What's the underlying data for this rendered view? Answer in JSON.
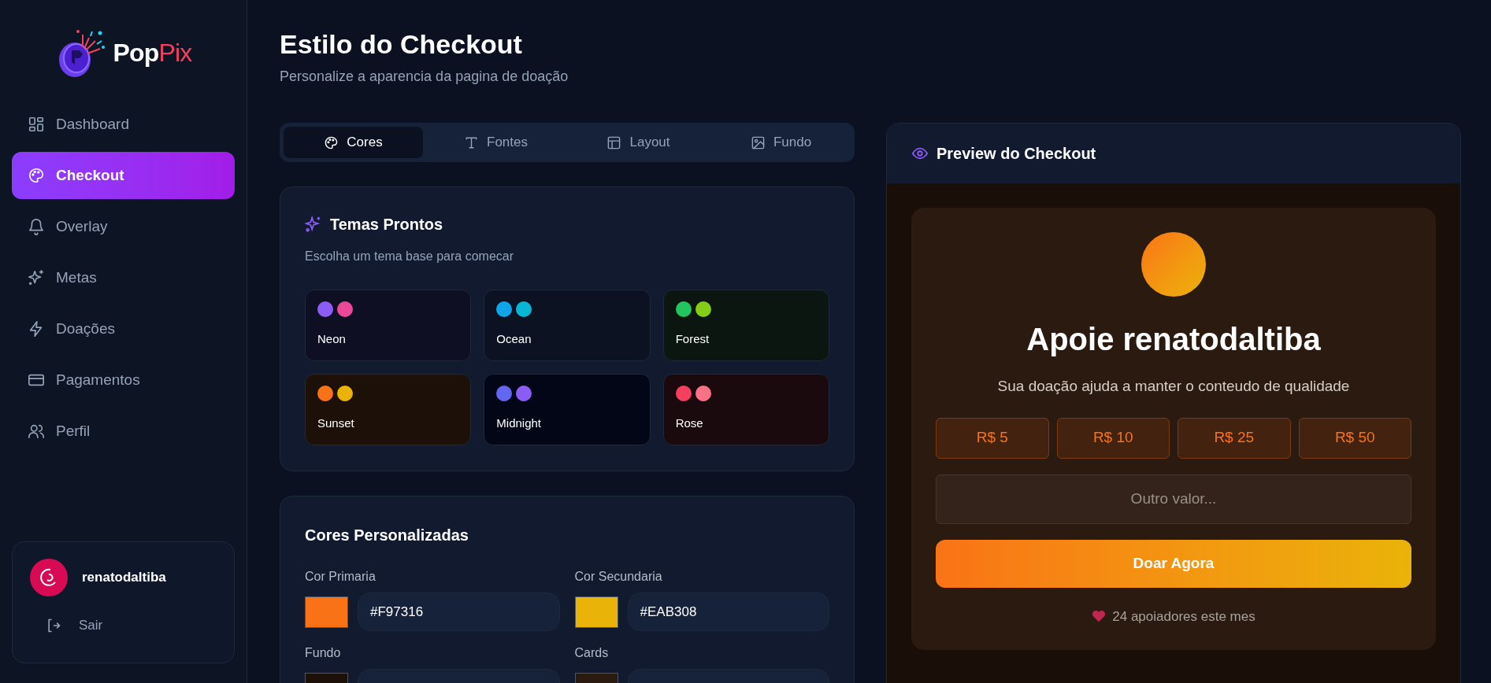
{
  "logo": {
    "part_1": "Pop",
    "part_2": "Pix"
  },
  "sidebar": {
    "items": [
      {
        "label": "Dashboard",
        "selected": false
      },
      {
        "label": "Checkout",
        "selected": true
      },
      {
        "label": "Overlay",
        "selected": false
      },
      {
        "label": "Metas",
        "selected": false
      },
      {
        "label": "Doações",
        "selected": false
      },
      {
        "label": "Pagamentos",
        "selected": false
      },
      {
        "label": "Perfil",
        "selected": false
      }
    ],
    "user": {
      "name": "renatodaltiba",
      "logout": "Sair"
    }
  },
  "page": {
    "title": "Estilo do Checkout",
    "subtitle": "Personalize a aparencia da pagina de doação"
  },
  "tabs": [
    {
      "label": "Cores",
      "selected": true
    },
    {
      "label": "Fontes",
      "selected": false
    },
    {
      "label": "Layout",
      "selected": false
    },
    {
      "label": "Fundo",
      "selected": false
    }
  ],
  "themes": {
    "title": "Temas Prontos",
    "subtitle": "Escolha um tema base para comecar",
    "items": [
      {
        "name": "Neon",
        "color": "#0f0f23",
        "dots": [
          {
            "color": "#8b5cf6"
          },
          {
            "color": "#ec4899"
          }
        ]
      },
      {
        "name": "Ocean",
        "color": "#0c1222",
        "dots": [
          {
            "color": "#0ea5e9"
          },
          {
            "color": "#06b6d4"
          }
        ]
      },
      {
        "name": "Forest",
        "color": "#0a160f",
        "dots": [
          {
            "color": "#22c55e"
          },
          {
            "color": "#84cc16"
          }
        ]
      },
      {
        "name": "Sunset",
        "color": "#1c1008",
        "dots": [
          {
            "color": "#f97316"
          },
          {
            "color": "#eab308"
          }
        ]
      },
      {
        "name": "Midnight",
        "color": "#020617",
        "dots": [
          {
            "color": "#6366f1"
          },
          {
            "color": "#8b5cf6"
          }
        ]
      },
      {
        "name": "Rose",
        "color": "#1a0a0e",
        "dots": [
          {
            "color": "#f43f5e"
          },
          {
            "color": "#fb7185"
          }
        ]
      }
    ]
  },
  "custom_colors": {
    "title": "Cores Personalizadas",
    "fields": [
      {
        "label": "Cor Primaria",
        "color": "#f97316",
        "value": "#F97316"
      },
      {
        "label": "Cor Secundaria",
        "color": "#eab308",
        "value": "#EAB308"
      },
      {
        "label": "Fundo",
        "color": "#1c1008"
      },
      {
        "label": "Cards",
        "color": "#2a1a10"
      }
    ]
  },
  "preview": {
    "title": "Preview do Checkout",
    "heading": "Apoie renatodaltiba",
    "description": "Sua doação ajuda a manter o conteudo de qualidade",
    "amounts": [
      "R$ 5",
      "R$ 10",
      "R$ 25",
      "R$ 50"
    ],
    "amount_placeholder": "Outro valor...",
    "button": "Doar Agora",
    "supporters": "24 apoiadores este mes"
  }
}
